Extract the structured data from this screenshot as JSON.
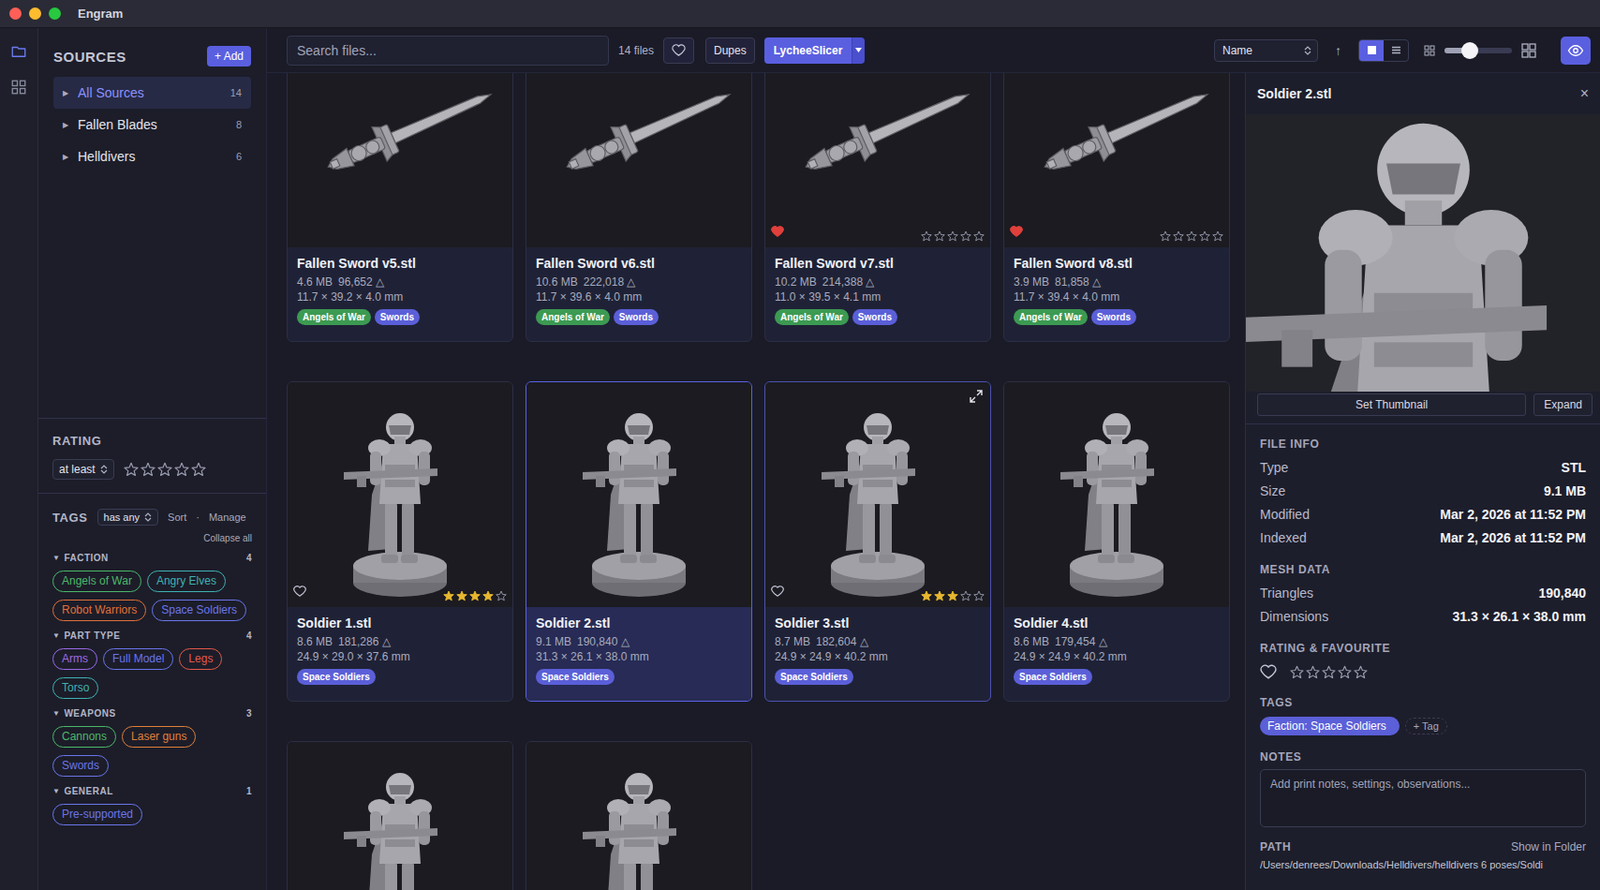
{
  "window": {
    "title": "Engram"
  },
  "rail": [
    {
      "kind": "folder",
      "selected": true
    },
    {
      "kind": "grid",
      "selected": false
    }
  ],
  "sidebar": {
    "heading": "SOURCES",
    "add_button": "+ Add",
    "sources": [
      {
        "arrow": "▶",
        "label": "All Sources",
        "count": "14",
        "selected": true
      },
      {
        "arrow": "▶",
        "label": "Fallen Blades",
        "count": "8",
        "selected": false
      },
      {
        "arrow": "▶",
        "label": "Helldivers",
        "count": "6",
        "selected": false
      }
    ]
  },
  "rating_filter": {
    "heading": "RATING",
    "mode": "at least",
    "stars": 0
  },
  "tag_filter": {
    "heading": "TAGS",
    "mode": "has any",
    "sort": "Sort",
    "separator": "·",
    "manage": "Manage",
    "collapse": "Collapse all",
    "groups": [
      {
        "arrow": "▼",
        "name": "FACTION",
        "count": "4",
        "tags": [
          {
            "label": "Angels of War",
            "color": "#4cb86a"
          },
          {
            "label": "Angry Elves",
            "color": "#3fb2b2"
          },
          {
            "label": "Robot Warriors",
            "color": "#e0703a"
          },
          {
            "label": "Space Soldiers",
            "color": "#6b75ea"
          }
        ]
      },
      {
        "arrow": "▼",
        "name": "PART TYPE",
        "count": "4",
        "tags": [
          {
            "label": "Arms",
            "color": "#9b6be8"
          },
          {
            "label": "Full Model",
            "color": "#6b75ea"
          },
          {
            "label": "Legs",
            "color": "#e25a4a"
          },
          {
            "label": "Torso",
            "color": "#3fb2b2"
          }
        ]
      },
      {
        "arrow": "▼",
        "name": "WEAPONS",
        "count": "3",
        "tags": [
          {
            "label": "Cannons",
            "color": "#4cb86a"
          },
          {
            "label": "Laser guns",
            "color": "#e0803a"
          },
          {
            "label": "Swords",
            "color": "#6b75ea"
          }
        ]
      },
      {
        "arrow": "▼",
        "name": "GENERAL",
        "count": "1",
        "tags": [
          {
            "label": "Pre-supported",
            "color": "#6b75ea"
          }
        ]
      }
    ]
  },
  "toolbar": {
    "search_placeholder": "Search files...",
    "file_count": "14 files",
    "favourites_only": false,
    "dupes": "Dupes",
    "slicer": "LycheeSlicer",
    "sort": "Name",
    "sort_arrow": "↑",
    "views": [
      {
        "kind": "grid",
        "selected": true
      },
      {
        "kind": "list",
        "selected": false
      }
    ],
    "thumb_size": 0.37,
    "preview_on": true
  },
  "files": [
    {
      "kind": "sword",
      "name": "Fallen Sword v5.stl",
      "size": "4.6 MB",
      "triangles": "96,652 △",
      "dims": "11.7 × 39.2 × 4.0 mm",
      "tags": [
        {
          "label": "Angels of War",
          "color": "#3c9a52"
        },
        {
          "label": "Swords",
          "color": "#5b5fd8"
        }
      ],
      "rating_shown": false,
      "favourite": false,
      "stars": 0,
      "selected": false,
      "hovered": false
    },
    {
      "kind": "sword",
      "name": "Fallen Sword v6.stl",
      "size": "10.6 MB",
      "triangles": "222,018 △",
      "dims": "11.7 × 39.6 × 4.0 mm",
      "tags": [
        {
          "label": "Angels of War",
          "color": "#3c9a52"
        },
        {
          "label": "Swords",
          "color": "#5b5fd8"
        }
      ],
      "rating_shown": false,
      "favourite": false,
      "stars": 0,
      "selected": false,
      "hovered": false
    },
    {
      "kind": "sword",
      "name": "Fallen Sword v7.stl",
      "size": "10.2 MB",
      "triangles": "214,388 △",
      "dims": "11.0 × 39.5 × 4.1 mm",
      "tags": [
        {
          "label": "Angels of War",
          "color": "#3c9a52"
        },
        {
          "label": "Swords",
          "color": "#5b5fd8"
        }
      ],
      "rating_shown": true,
      "favourite": true,
      "stars": 0,
      "selected": false,
      "hovered": false
    },
    {
      "kind": "sword",
      "name": "Fallen Sword v8.stl",
      "size": "3.9 MB",
      "triangles": "81,858 △",
      "dims": "11.7 × 39.4 × 4.0 mm",
      "tags": [
        {
          "label": "Angels of War",
          "color": "#3c9a52"
        },
        {
          "label": "Swords",
          "color": "#5b5fd8"
        }
      ],
      "rating_shown": true,
      "favourite": true,
      "stars": 0,
      "selected": false,
      "hovered": false
    },
    {
      "kind": "soldier",
      "name": "Soldier 1.stl",
      "size": "8.6 MB",
      "triangles": "181,286 △",
      "dims": "24.9 × 29.0 × 37.6 mm",
      "tags": [
        {
          "label": "Space Soldiers",
          "color": "#5b5fd8"
        }
      ],
      "rating_shown": true,
      "favourite": false,
      "stars": 4,
      "selected": false,
      "hovered": false
    },
    {
      "kind": "soldier",
      "name": "Soldier 2.stl",
      "size": "9.1 MB",
      "triangles": "190,840 △",
      "dims": "31.3 × 26.1 × 38.0 mm",
      "tags": [
        {
          "label": "Space Soldiers",
          "color": "#5b5fd8"
        }
      ],
      "rating_shown": false,
      "favourite": false,
      "stars": 0,
      "selected": true,
      "hovered": false
    },
    {
      "kind": "soldier",
      "name": "Soldier 3.stl",
      "size": "8.7 MB",
      "triangles": "182,604 △",
      "dims": "24.9 × 24.9 × 40.2 mm",
      "tags": [
        {
          "label": "Space Soldiers",
          "color": "#5b5fd8"
        }
      ],
      "rating_shown": true,
      "favourite": false,
      "stars": 3,
      "selected": false,
      "hovered": true
    },
    {
      "kind": "soldier",
      "name": "Soldier 4.stl",
      "size": "8.6 MB",
      "triangles": "179,454 △",
      "dims": "24.9 × 24.9 × 40.2 mm",
      "tags": [
        {
          "label": "Space Soldiers",
          "color": "#5b5fd8"
        }
      ],
      "rating_shown": false,
      "favourite": false,
      "stars": 0,
      "selected": false,
      "hovered": false
    },
    {
      "kind": "soldier",
      "selected": false,
      "hovered": false
    },
    {
      "kind": "soldier",
      "selected": false,
      "hovered": false
    }
  ],
  "detail": {
    "title": "Soldier 2.stl",
    "close": "×",
    "set_thumbnail": "Set Thumbnail",
    "expand": "Expand",
    "file_info": {
      "heading": "FILE INFO",
      "rows": [
        [
          "Type",
          "STL"
        ],
        [
          "Size",
          "9.1 MB"
        ],
        [
          "Modified",
          "Mar 2, 2026 at 11:52 PM"
        ],
        [
          "Indexed",
          "Mar 2, 2026 at 11:52 PM"
        ]
      ]
    },
    "mesh": {
      "heading": "MESH DATA",
      "rows": [
        [
          "Triangles",
          "190,840"
        ],
        [
          "Dimensions",
          "31.3 × 26.1 × 38.0 mm"
        ]
      ]
    },
    "rating": {
      "heading": "RATING & FAVOURITE",
      "favourite": false,
      "stars": 0
    },
    "tags": {
      "heading": "TAGS",
      "items": [
        {
          "label": "Faction: Space Soldiers",
          "color": "#5b5fd8"
        }
      ],
      "add": "+ Tag"
    },
    "notes": {
      "heading": "NOTES",
      "placeholder": "Add print notes, settings, observations..."
    },
    "path": {
      "heading": "PATH",
      "show": "Show in Folder",
      "value": "/Users/denrees/Downloads/Helldivers/helldivers 6 poses/Soldi"
    }
  }
}
